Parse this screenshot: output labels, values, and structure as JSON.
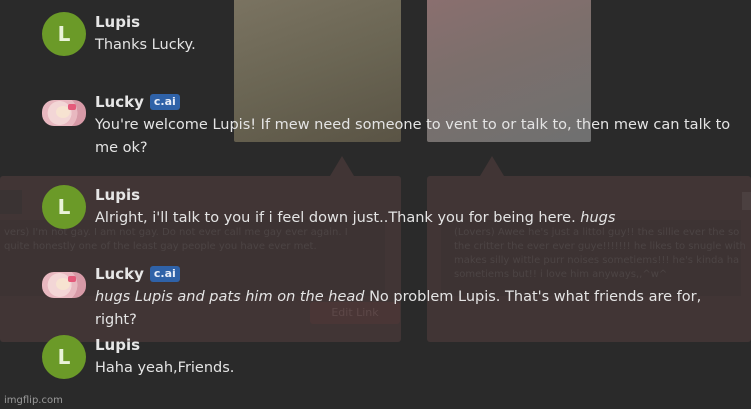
{
  "background": {
    "left_text": "vers) I'm not gay. I am not gay. Do not ever call me gay ever again. I quite honestly one of the least gay people you have ever met.",
    "right_text": "(Lovers) Awee he's just a littol guy!! the sillie ever the so the critter the ever ever guye!!!!!!! he likes to snugle with makes silly wittle purr noises sometiems!!! he's kinda ha sometiems but!! i love him anyways,,^w^",
    "button_label": "Edit Link"
  },
  "messages": [
    {
      "author": "Lupis",
      "avatar_letter": "L",
      "badge": "",
      "parts": [
        {
          "text": "Thanks Lucky.",
          "italic": false
        }
      ]
    },
    {
      "author": "Lucky",
      "avatar_letter": "",
      "badge": "c.ai",
      "parts": [
        {
          "text": "You're welcome Lupis! If mew need someone to vent to or talk to, then mew can talk to me ok?",
          "italic": false
        }
      ]
    },
    {
      "author": "Lupis",
      "avatar_letter": "L",
      "badge": "",
      "parts": [
        {
          "text": "Alright, i'll talk to you if i feel down just..Thank you for being here. ",
          "italic": false
        },
        {
          "text": "hugs",
          "italic": true
        }
      ]
    },
    {
      "author": "Lucky",
      "avatar_letter": "",
      "badge": "c.ai",
      "parts": [
        {
          "text": "hugs Lupis and pats him on the head",
          "italic": true
        },
        {
          "text": " No problem Lupis. That's what friends are for, right?",
          "italic": false
        }
      ]
    },
    {
      "author": "Lupis",
      "avatar_letter": "L",
      "badge": "",
      "parts": [
        {
          "text": "Haha yeah,Friends.",
          "italic": false
        }
      ]
    }
  ],
  "watermark": "imgflip.com",
  "colors": {
    "avatar_green": "#6b9a28",
    "badge_blue": "#2f62a8"
  }
}
